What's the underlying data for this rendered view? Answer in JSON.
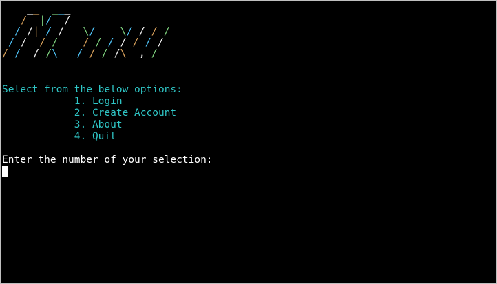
{
  "banner_ascii": "    __  ___\n   /  |/  /__  ____  __  __\n  / /|_/ / _ \\/ __ \\/ / / /\n / /  / /  __/ / / / /_/ /\n/_/  /_/\\___/_/ /_/\\__,_/",
  "banner_colors": [
    "#f2f2f2",
    "#d9a25c",
    "#7fd27f",
    "#4fc3f7"
  ],
  "prompt": {
    "heading": "Select from the below options:",
    "options": [
      "            1. Login",
      "            2. Create Account",
      "            3. About",
      "            4. Quit"
    ],
    "input_label": "Enter the number of your selection:"
  },
  "colors": {
    "background": "#000000",
    "accent": "#2fc6c6",
    "text": "#ffffff"
  }
}
